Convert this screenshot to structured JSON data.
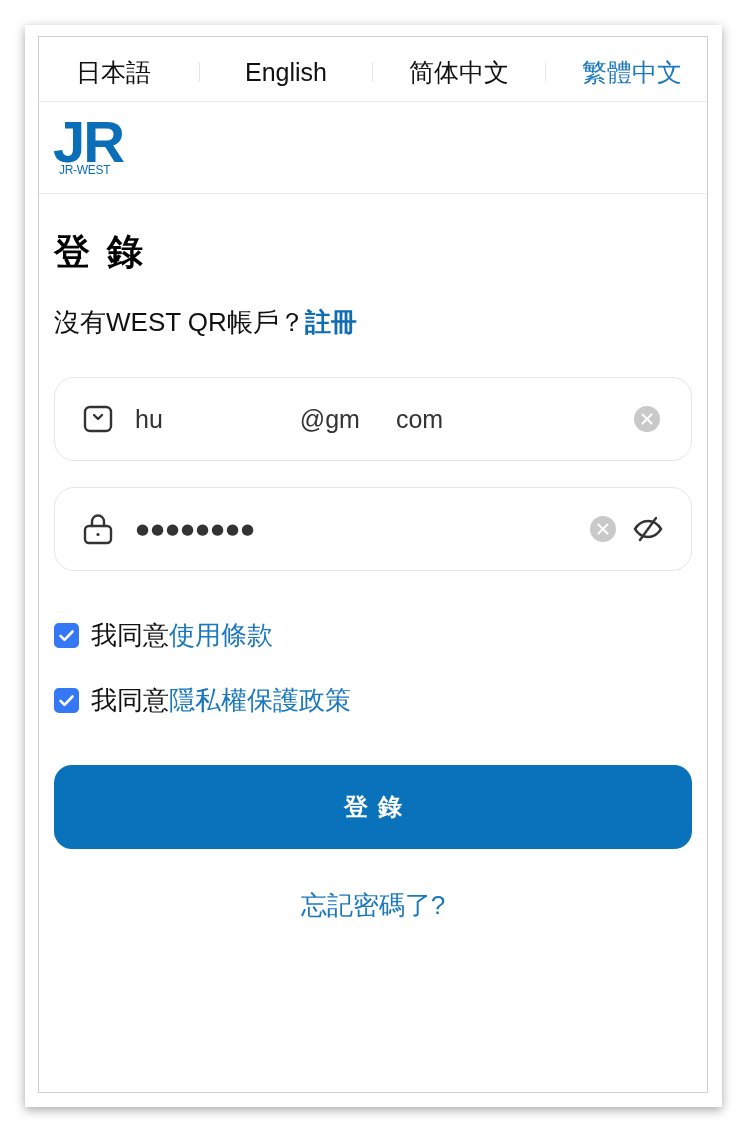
{
  "language_bar": {
    "tabs": [
      {
        "label": "日本語",
        "selected": false
      },
      {
        "label": "English",
        "selected": false
      },
      {
        "label": "简体中文",
        "selected": false
      },
      {
        "label": "繁體中文",
        "selected": true
      }
    ]
  },
  "header": {
    "logo": {
      "mark": "JR",
      "caption": "JR-WEST"
    }
  },
  "login": {
    "title": "登錄",
    "signup_prompt": {
      "text": "沒有WEST QR帳戶？",
      "link": "註冊"
    },
    "email_field": {
      "value_fragments": [
        "hu",
        "@gm",
        "com"
      ]
    },
    "password_field": {
      "value": "●●●●●●●●"
    },
    "agreements": [
      {
        "text": "我同意",
        "link": "使用條款",
        "checked": true
      },
      {
        "text": "我同意",
        "link": "隱私權保護政策",
        "checked": true
      }
    ],
    "submit_button": {
      "label": "登錄"
    },
    "forgot_password_link": "忘記密碼了?"
  }
}
